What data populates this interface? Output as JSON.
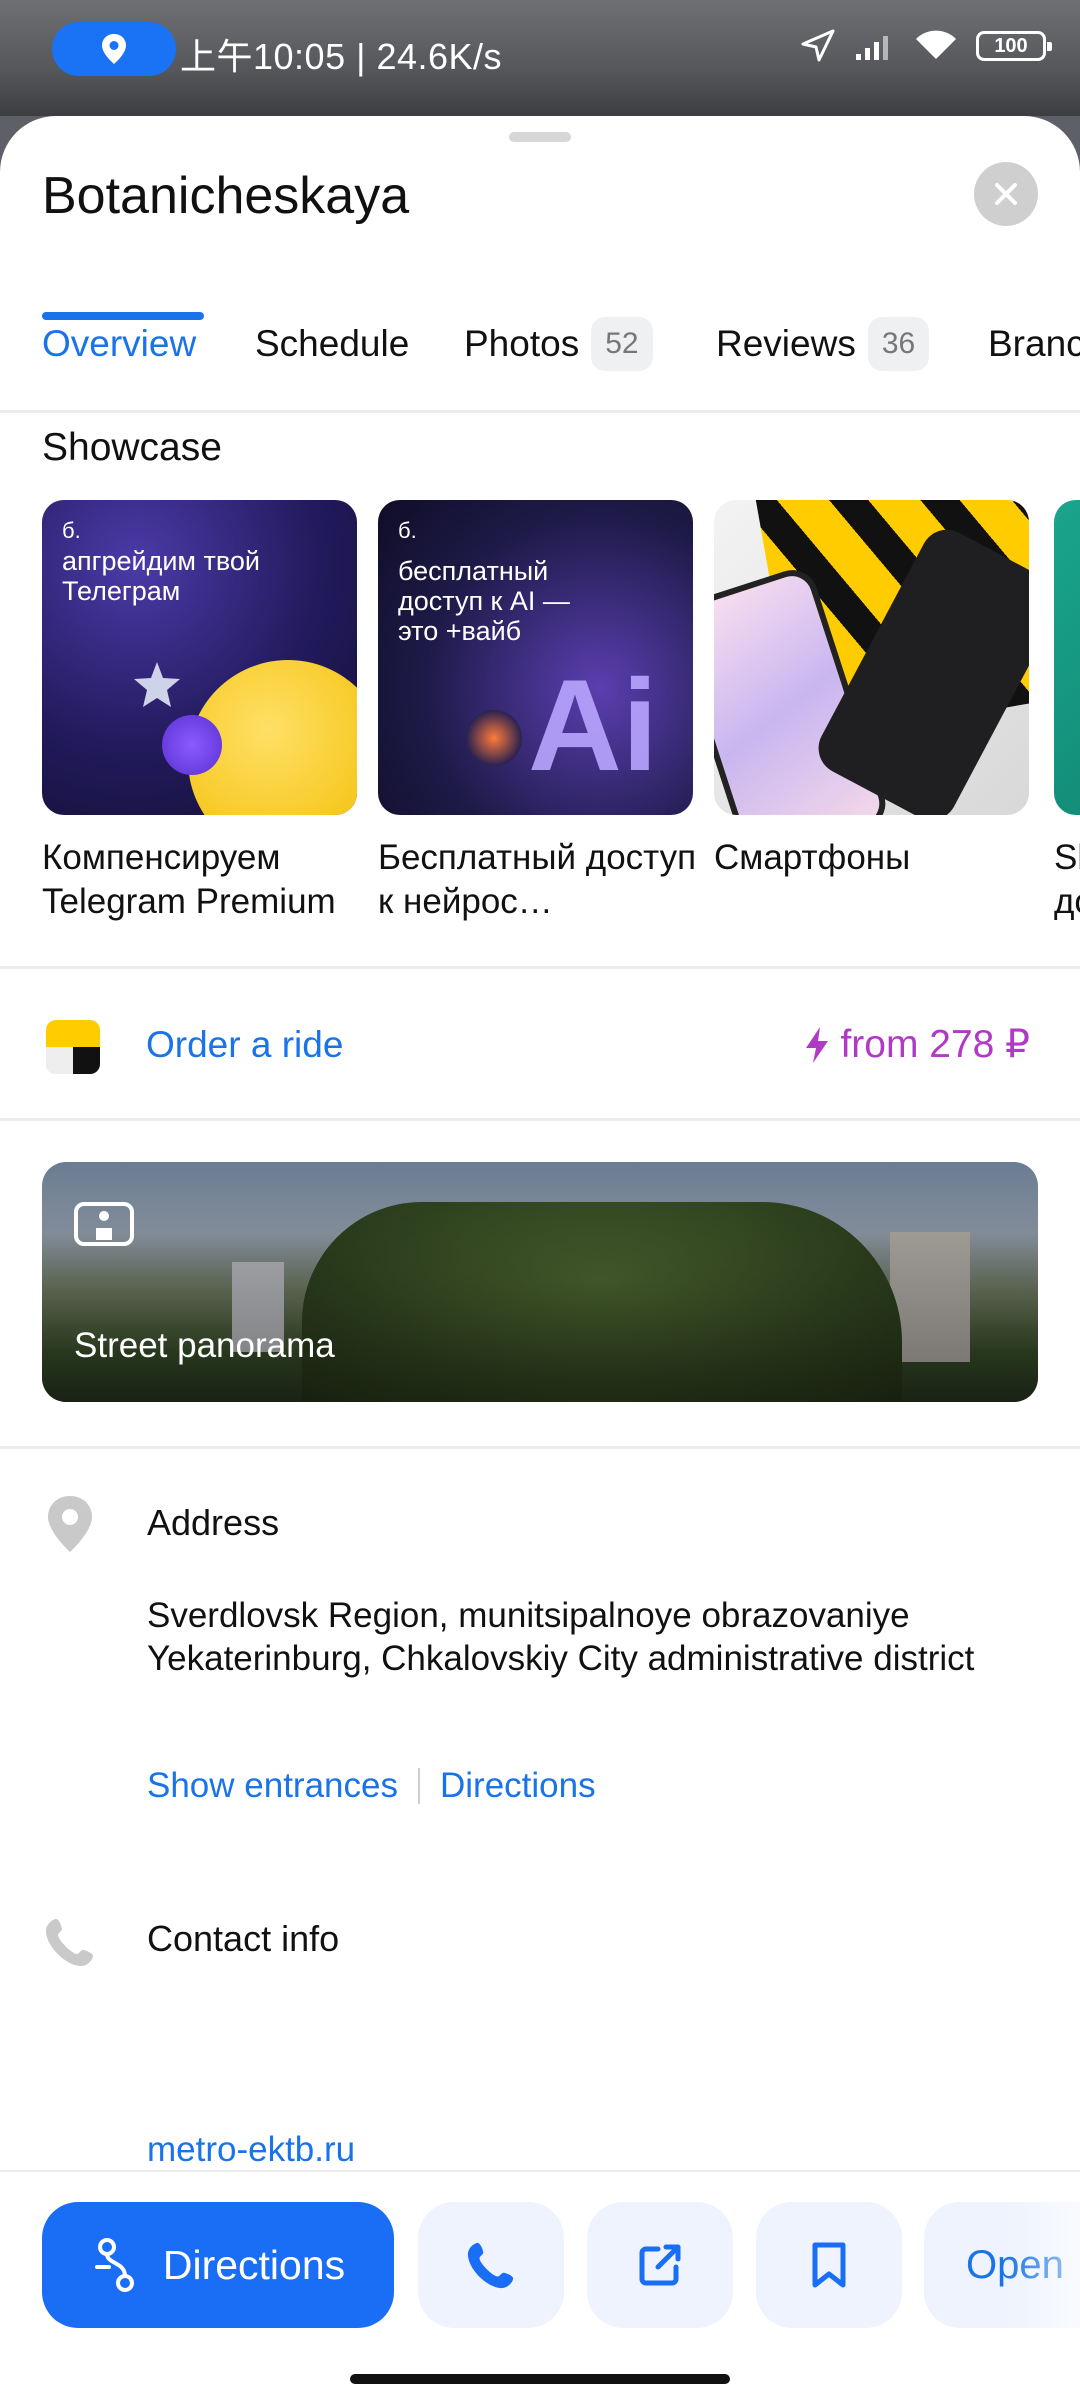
{
  "status_bar": {
    "time_speed": "上午10:05 | 24.6K/s",
    "battery": "100"
  },
  "header": {
    "title": "Botanicheskaya"
  },
  "tabs": [
    {
      "label": "Overview",
      "badge": ""
    },
    {
      "label": "Schedule",
      "badge": ""
    },
    {
      "label": "Photos",
      "badge": "52"
    },
    {
      "label": "Reviews",
      "badge": "36"
    },
    {
      "label": "Branc",
      "badge": ""
    }
  ],
  "showcase": {
    "title": "Showcase",
    "cards": [
      {
        "label": "Компенсируем Telegram Premium",
        "brand": "б.",
        "text": "апгрейдим твой Телеграм"
      },
      {
        "label": "Бесплатный доступ к нейрос…",
        "brand": "б.",
        "text": "бесплатный доступ к AI — это +вайб"
      },
      {
        "label": "Смартфоны"
      },
      {
        "label": "Sl до"
      }
    ]
  },
  "ride": {
    "label": "Order a ride",
    "price": "from 278 ₽"
  },
  "panorama": {
    "label": "Street panorama"
  },
  "address": {
    "title": "Address",
    "text": "Sverdlovsk Region, munitsipalnoye obrazovaniye Yekaterinburg, Chkalovskiy City administrative district",
    "link_entrances": "Show entrances",
    "link_directions": "Directions"
  },
  "contact": {
    "title": "Contact info",
    "website": "metro-ektb.ru"
  },
  "bottom_bar": {
    "directions": "Directions",
    "open": "Open"
  },
  "colors": {
    "accent": "#1a73e8",
    "price": "#b03ac6",
    "primary_button": "#1a6df5"
  }
}
